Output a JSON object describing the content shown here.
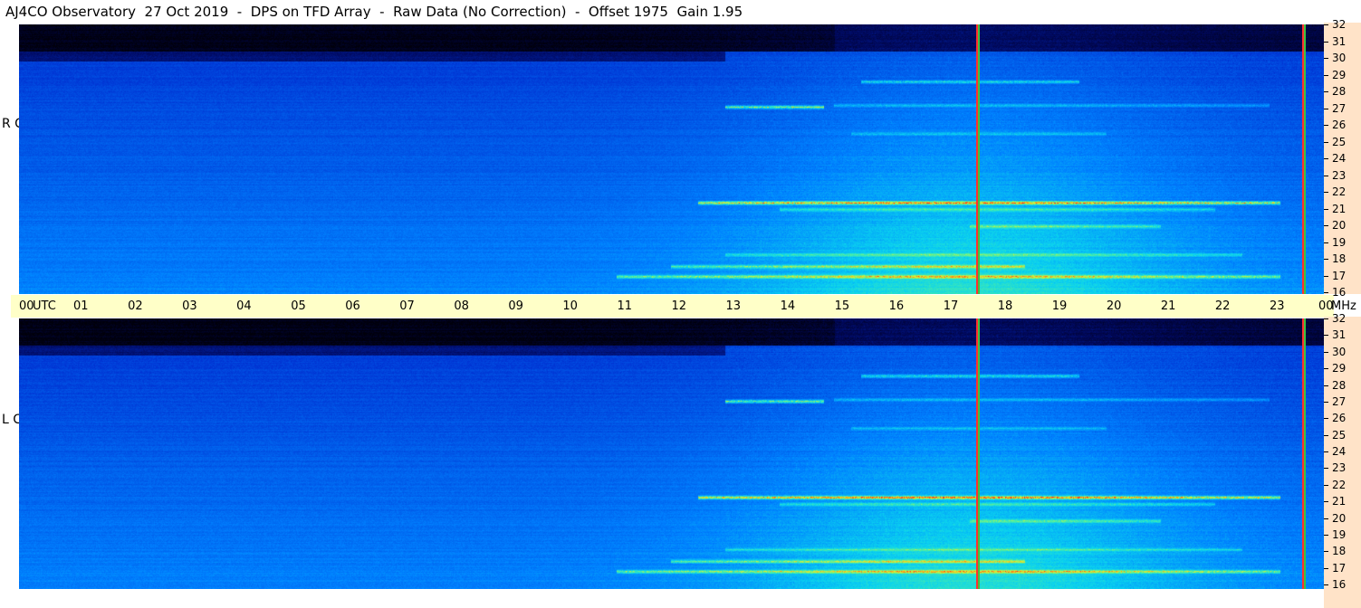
{
  "header": {
    "title": "AJ4CO Observatory  27 Oct 2019  -  DPS on TFD Array  -  Raw Data (No Correction)  -  Offset 1975  Gain 1.95"
  },
  "panels": {
    "rcp_label": "R C P",
    "lcp_label": "L C P"
  },
  "colors": {
    "time_axis_bg": "#ffffc8",
    "freq_axis_bg": "#ffe3c8",
    "marker_red": "#ff3030",
    "marker_green": "#40c040"
  },
  "chart_data": {
    "type": "heatmap",
    "time_axis": {
      "unit": "UTC",
      "labels": [
        "00",
        "01",
        "02",
        "03",
        "04",
        "05",
        "06",
        "07",
        "08",
        "09",
        "10",
        "11",
        "12",
        "13",
        "14",
        "15",
        "16",
        "17",
        "18",
        "19",
        "20",
        "21",
        "22",
        "23",
        "00"
      ],
      "range_hours": [
        0,
        24
      ]
    },
    "frequency_axis": {
      "unit": "MHz",
      "labels": [
        "32",
        "31",
        "30",
        "29",
        "28",
        "27",
        "26",
        "25",
        "24",
        "23",
        "22",
        "21",
        "20",
        "19",
        "18",
        "17",
        "16"
      ],
      "range_mhz": [
        16,
        32
      ]
    },
    "markers_utc_hours": [
      17.6,
      23.6
    ],
    "bands_mhz": [
      {
        "freq": 21.4,
        "start": 12.5,
        "end": 23.2,
        "strength": 1.0
      },
      {
        "freq": 27.1,
        "start": 13.0,
        "end": 14.8,
        "strength": 0.9
      },
      {
        "freq": 28.6,
        "start": 15.5,
        "end": 19.5,
        "strength": 0.6
      },
      {
        "freq": 17.0,
        "start": 11.0,
        "end": 23.2,
        "strength": 0.7
      },
      {
        "freq": 17.6,
        "start": 12.0,
        "end": 18.5,
        "strength": 0.6
      },
      {
        "freq": 20.0,
        "start": 17.5,
        "end": 21.0,
        "strength": 0.45
      },
      {
        "freq": 21.0,
        "start": 14.0,
        "end": 22.0,
        "strength": 0.4
      },
      {
        "freq": 27.2,
        "start": 15.0,
        "end": 23.0,
        "strength": 0.35
      },
      {
        "freq": 25.5,
        "start": 15.3,
        "end": 20.0,
        "strength": 0.3
      },
      {
        "freq": 18.3,
        "start": 13.0,
        "end": 22.5,
        "strength": 0.35
      }
    ]
  }
}
